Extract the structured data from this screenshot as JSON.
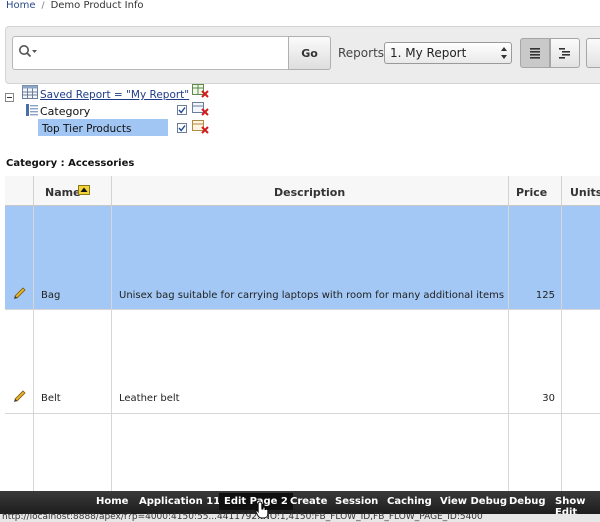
{
  "breadcrumb": {
    "items": [
      "Home",
      "Demo Product Info"
    ]
  },
  "search": {
    "value": "",
    "placeholder": "",
    "go_label": "Go",
    "reports_label": "Reports",
    "reports_selected": "1. My Report"
  },
  "report_settings": {
    "saved_report": "Saved Report = \"My Report\"",
    "category_label": "Category",
    "filter_label": "Top Tier Products"
  },
  "category_heading": "Category : Accessories",
  "table": {
    "columns": [
      "Name",
      "Description",
      "Price",
      "Units"
    ],
    "rows": [
      {
        "name": "Bag",
        "description": "Unisex bag suitable for carrying laptops with room for many additional items",
        "price": "125"
      },
      {
        "name": "Belt",
        "description": "Leather belt",
        "price": "30"
      },
      {
        "name": "",
        "description": "",
        "price": ""
      }
    ]
  },
  "dev_toolbar": {
    "items": [
      "Home",
      "Application 111",
      "Edit Page 2",
      "Create",
      "Session",
      "Caching",
      "View Debug",
      "Debug",
      "Show Edit"
    ]
  },
  "status_url": "http://localhost:8888/apex/f?p=4000:4150:55...4411792::NO:1,4150:FB_FLOW_ID,FB_FLOW_PAGE_ID:5400",
  "colors": {
    "selected_row": "#a3c8f5",
    "filter_highlight": "#a2c6f3",
    "link": "#1f3c88",
    "toolbar_bg": "#262626"
  },
  "icons": [
    "search-icon",
    "dropdown-arrow-icon",
    "view-list-icon",
    "view-group-icon",
    "collapse-icon",
    "report-grid-icon",
    "remove-icon",
    "checkbox-icon",
    "sort-ascending-icon",
    "edit-pencil-icon",
    "cursor-icon"
  ]
}
